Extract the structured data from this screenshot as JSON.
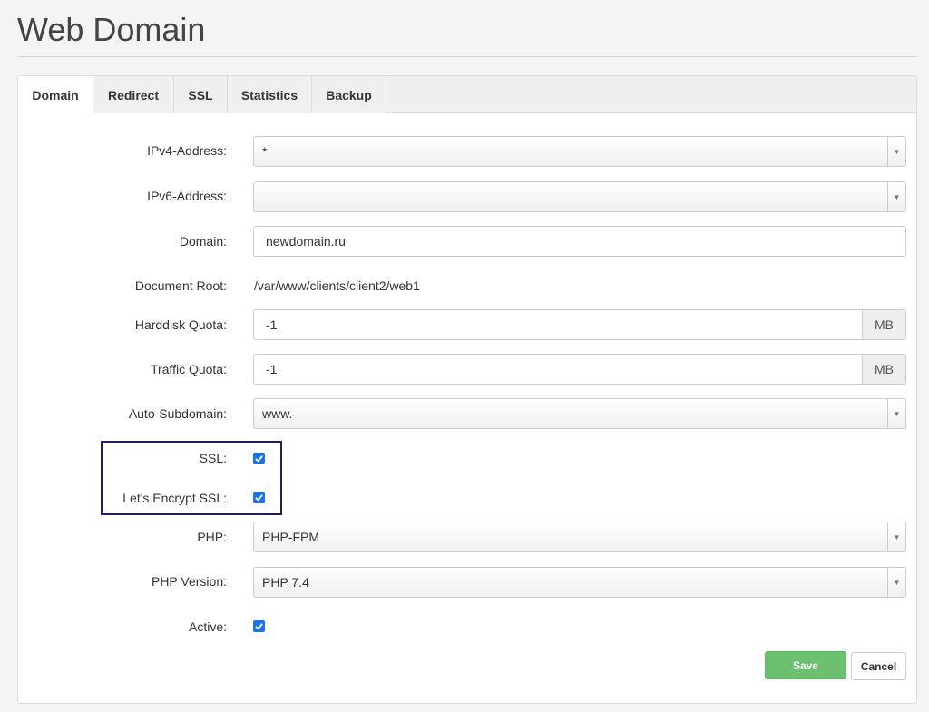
{
  "page": {
    "title": "Web Domain"
  },
  "tabs": [
    {
      "label": "Domain",
      "active": true
    },
    {
      "label": "Redirect",
      "active": false
    },
    {
      "label": "SSL",
      "active": false
    },
    {
      "label": "Statistics",
      "active": false
    },
    {
      "label": "Backup",
      "active": false
    }
  ],
  "form": {
    "ipv4": {
      "label": "IPv4-Address:",
      "value": "*"
    },
    "ipv6": {
      "label": "IPv6-Address:",
      "value": ""
    },
    "domain": {
      "label": "Domain:",
      "value": "newdomain.ru"
    },
    "document_root": {
      "label": "Document Root:",
      "value": "/var/www/clients/client2/web1"
    },
    "harddisk_quota": {
      "label": "Harddisk Quota:",
      "value": "-1",
      "unit": "MB"
    },
    "traffic_quota": {
      "label": "Traffic Quota:",
      "value": "-1",
      "unit": "MB"
    },
    "auto_subdomain": {
      "label": "Auto-Subdomain:",
      "value": "www."
    },
    "ssl": {
      "label": "SSL:",
      "checked": true
    },
    "letsencrypt": {
      "label": "Let's Encrypt SSL:",
      "checked": true
    },
    "php": {
      "label": "PHP:",
      "value": "PHP-FPM"
    },
    "php_version": {
      "label": "PHP Version:",
      "value": "PHP 7.4"
    },
    "active": {
      "label": "Active:",
      "checked": true
    }
  },
  "buttons": {
    "save_label": "Save",
    "cancel_label": "Cancel"
  },
  "colors": {
    "accent": "#1a73e8",
    "save": "#6cc070",
    "highlight_border": "#1f1d6e"
  },
  "icons": {
    "dropdown": "caret-down-icon",
    "checkbox": "check-icon"
  }
}
